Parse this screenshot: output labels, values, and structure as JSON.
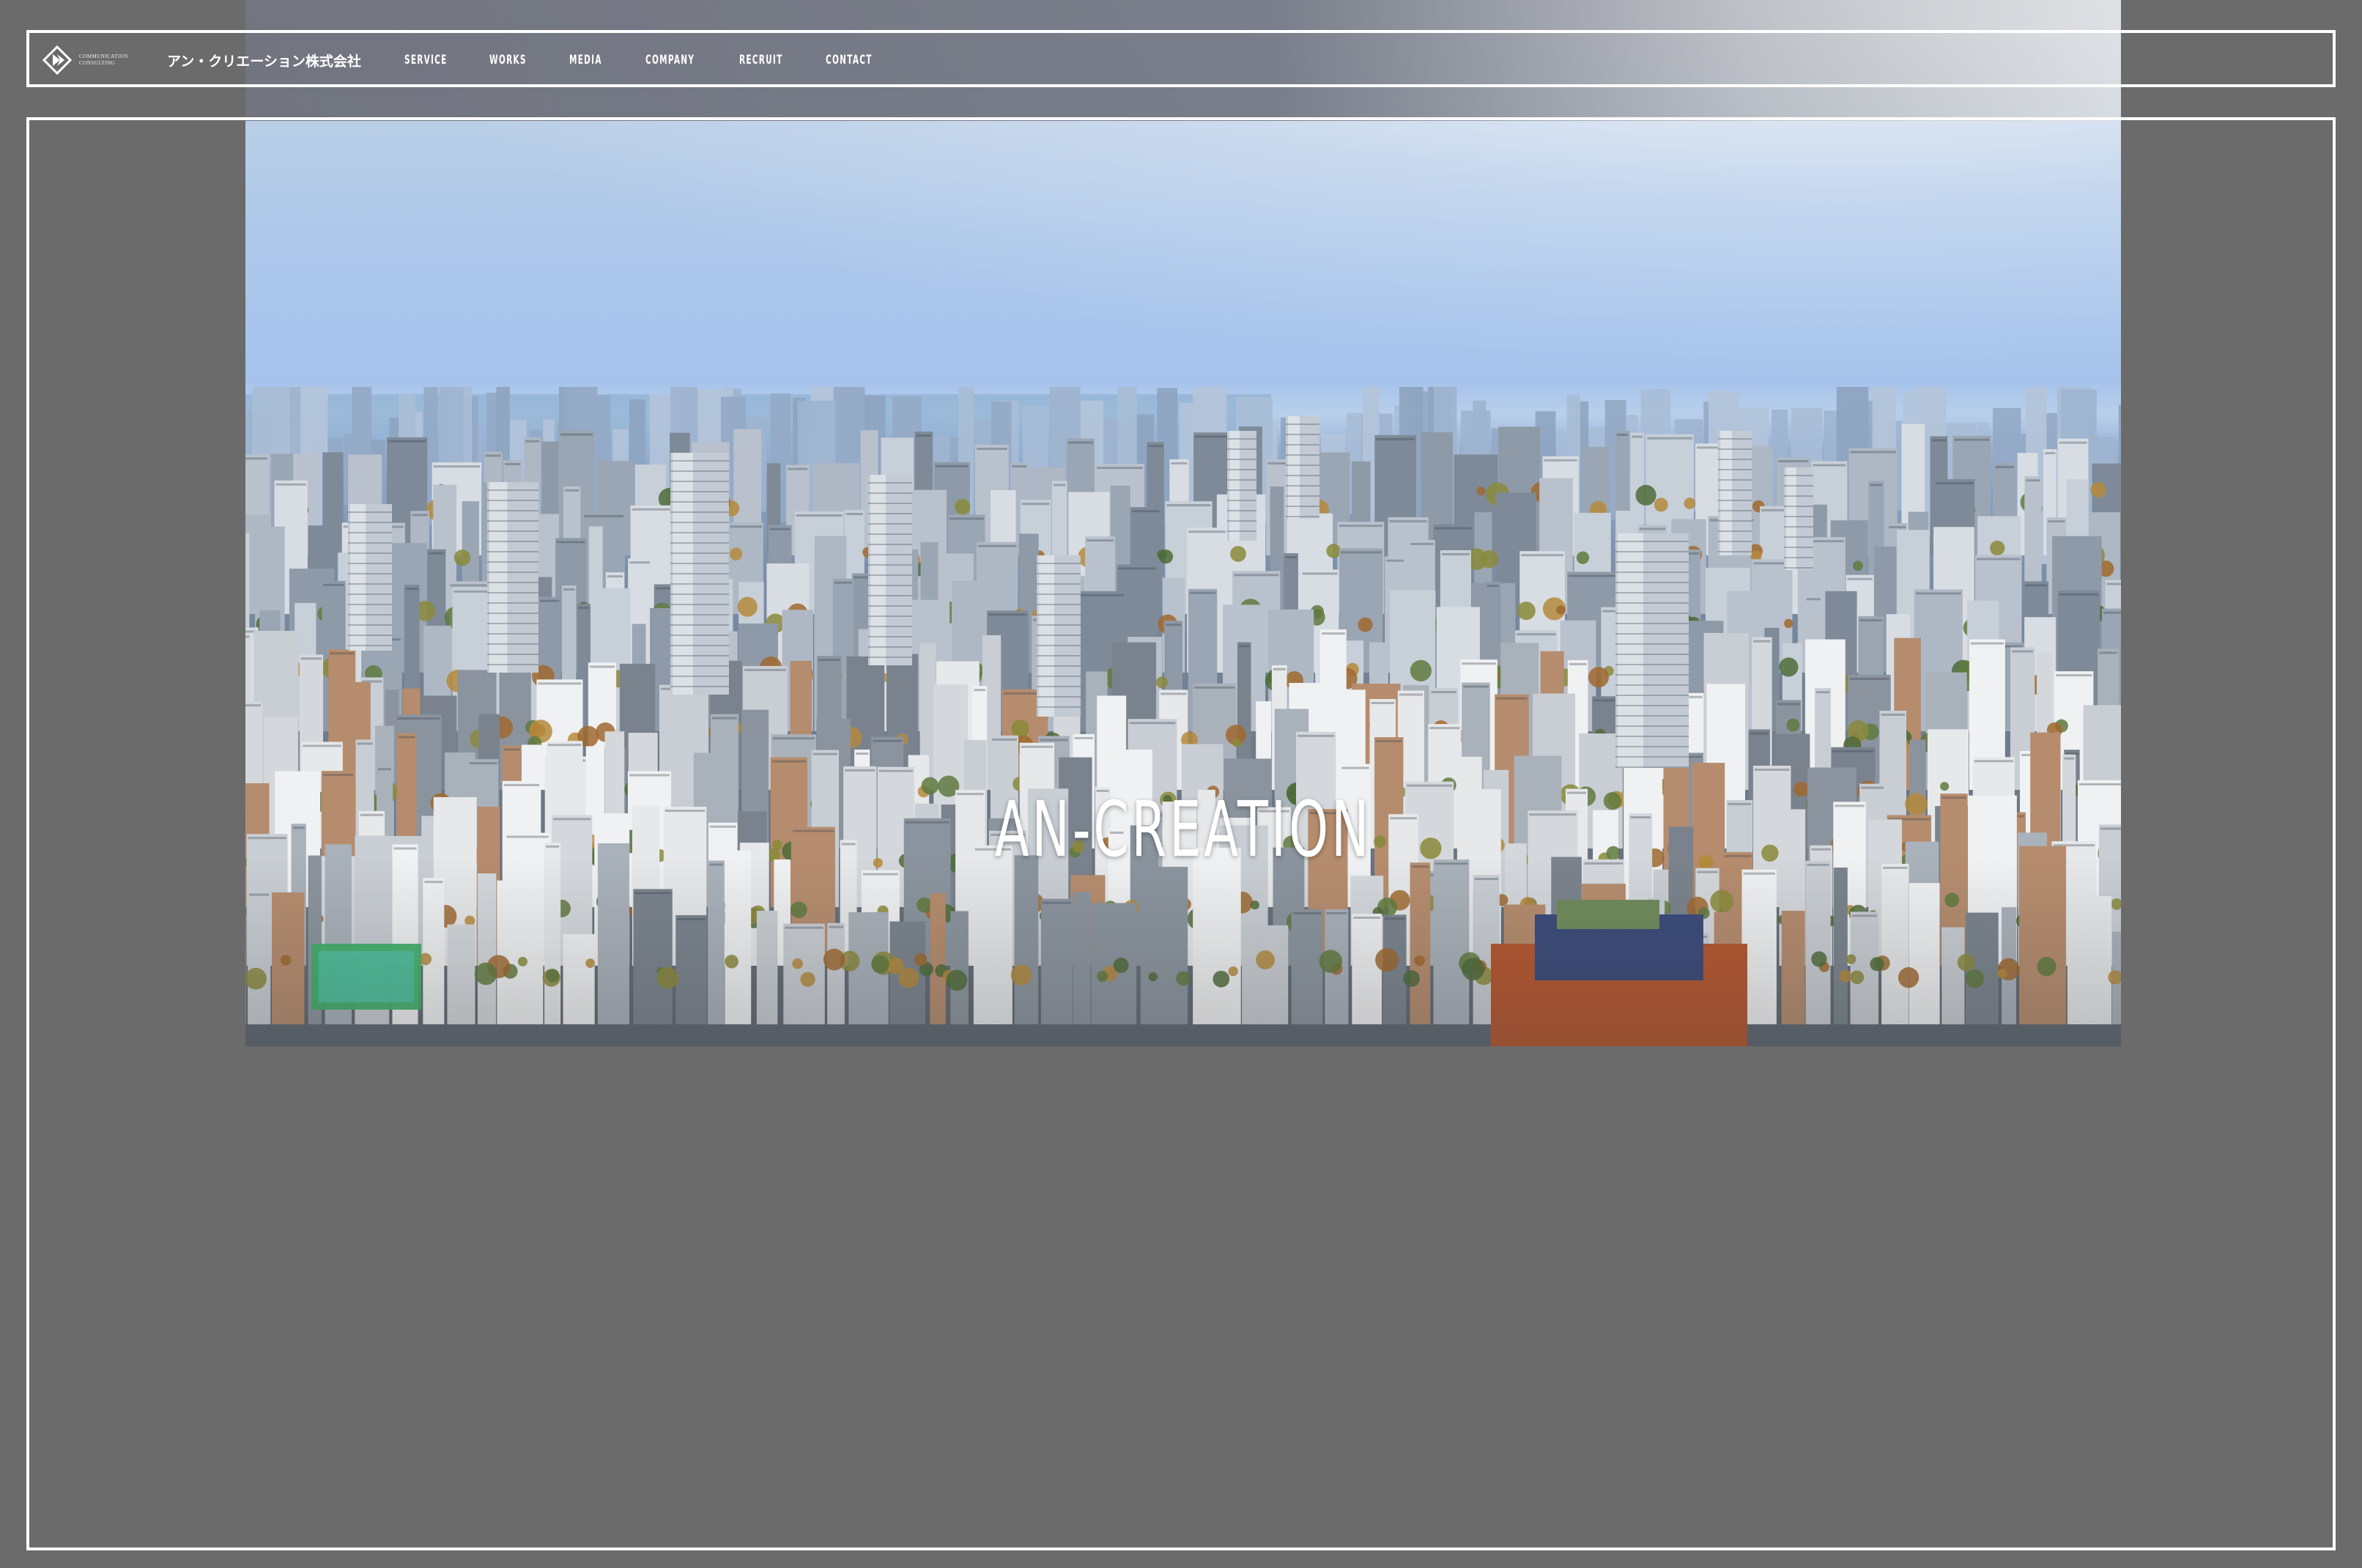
{
  "header": {
    "logo": {
      "tagline_line1": "COMMUNICATION",
      "tagline_line2": "CONSULTING",
      "company_name": "アン・クリエーション株式会社",
      "mark_icon": "an-creation-logo-icon"
    },
    "nav": [
      {
        "label": "SERVICE"
      },
      {
        "label": "WORKS"
      },
      {
        "label": "MEDIA"
      },
      {
        "label": "COMPANY"
      },
      {
        "label": "RECRUIT"
      },
      {
        "label": "CONTACT"
      }
    ]
  },
  "hero": {
    "title": "AN-CREATION",
    "image": "tokyo-city-aerial-photo"
  },
  "colors": {
    "page_background": "#6b6b6b",
    "frame_border": "#ffffff",
    "text": "#ffffff"
  }
}
